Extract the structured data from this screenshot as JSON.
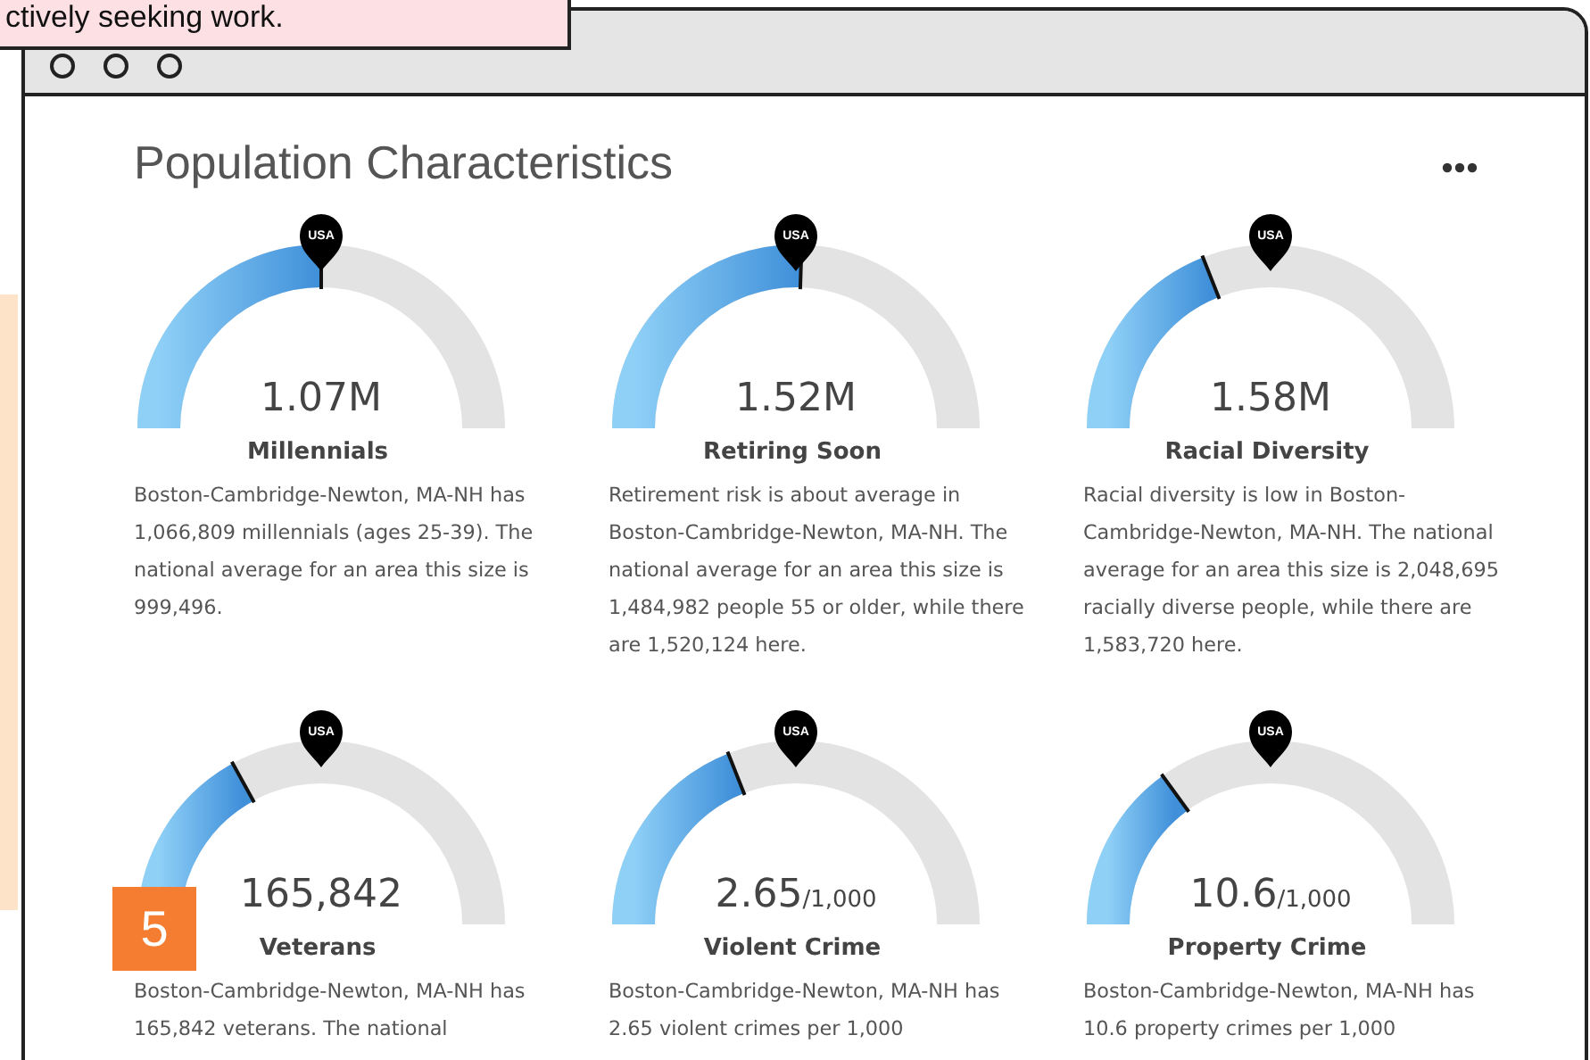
{
  "note": {
    "text": "ctively seeking work."
  },
  "badge": {
    "text": "5"
  },
  "panel": {
    "title": "Population Characteristics"
  },
  "gauges": [
    {
      "value": "1.07M",
      "label": "Millennials",
      "pin": "USA",
      "level": 0.5,
      "description": "Boston-Cambridge-Newton, MA-NH has 1,066,809 millennials (ages 25-39). The national average for an area this size is 999,496."
    },
    {
      "value": "1.52M",
      "label": "Retiring Soon",
      "pin": "USA",
      "level": 0.51,
      "description": "Retirement risk is about average in Boston-Cambridge-Newton, MA-NH. The national average for an area this size is 1,484,982 people 55 or older, while there are 1,520,124 here."
    },
    {
      "value": "1.58M",
      "label": "Racial Diversity",
      "pin": "USA",
      "level": 0.38,
      "description": "Racial diversity is low in Boston-Cambridge-Newton, MA-NH. The national average for an area this size is 2,048,695 racially diverse people, while there are 1,583,720 here."
    },
    {
      "value": "165,842",
      "label": "Veterans",
      "pin": "USA",
      "level": 0.34,
      "description": "Boston-Cambridge-Newton, MA-NH has 165,842 veterans. The national"
    },
    {
      "value": "2.65",
      "unit": "/1,000",
      "label": "Violent Crime",
      "pin": "USA",
      "level": 0.38,
      "description": "Boston-Cambridge-Newton, MA-NH has 2.65 violent crimes per 1,000"
    },
    {
      "value": "10.6",
      "unit": "/1,000",
      "label": "Property Crime",
      "pin": "USA",
      "level": 0.3,
      "description": "Boston-Cambridge-Newton, MA-NH has 10.6 property crimes per 1,000"
    }
  ]
}
